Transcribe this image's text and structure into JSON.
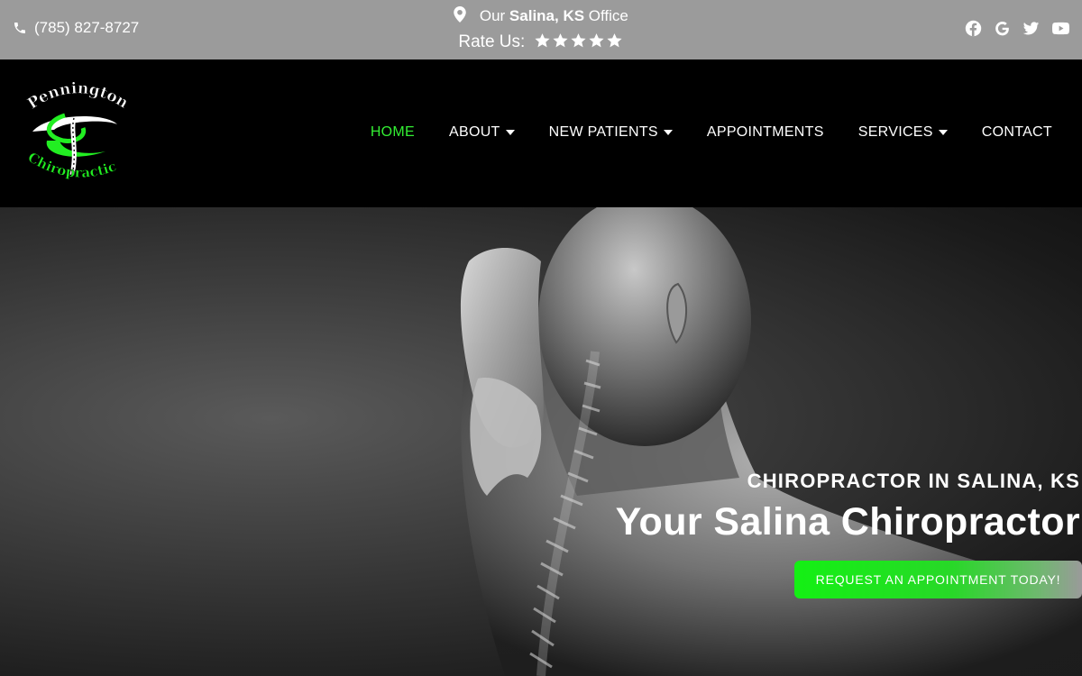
{
  "topbar": {
    "phone": "(785) 827-8727",
    "office_prefix": "Our",
    "office_city": "Salina, KS",
    "office_suffix": "Office",
    "rate_label": "Rate Us:",
    "star_count": 5,
    "social_icons": [
      "facebook-icon",
      "google-icon",
      "twitter-icon",
      "youtube-icon"
    ]
  },
  "logo": {
    "line1": "Pennington",
    "line2": "Chiropractic",
    "accent_color": "#22ee22"
  },
  "nav": {
    "items": [
      {
        "label": "HOME",
        "active": true,
        "dropdown": false
      },
      {
        "label": "ABOUT",
        "active": false,
        "dropdown": true
      },
      {
        "label": "NEW PATIENTS",
        "active": false,
        "dropdown": true
      },
      {
        "label": "APPOINTMENTS",
        "active": false,
        "dropdown": false
      },
      {
        "label": "SERVICES",
        "active": false,
        "dropdown": true
      },
      {
        "label": "CONTACT",
        "active": false,
        "dropdown": false
      }
    ]
  },
  "hero": {
    "subtitle": "CHIROPRACTOR IN SALINA, KS",
    "title": "Your Salina Chiropractor",
    "cta_label": "REQUEST AN APPOINTMENT TODAY!"
  },
  "colors": {
    "topbar_bg": "#9b9b9b",
    "header_bg": "#000000",
    "accent_green": "#22ee22"
  }
}
